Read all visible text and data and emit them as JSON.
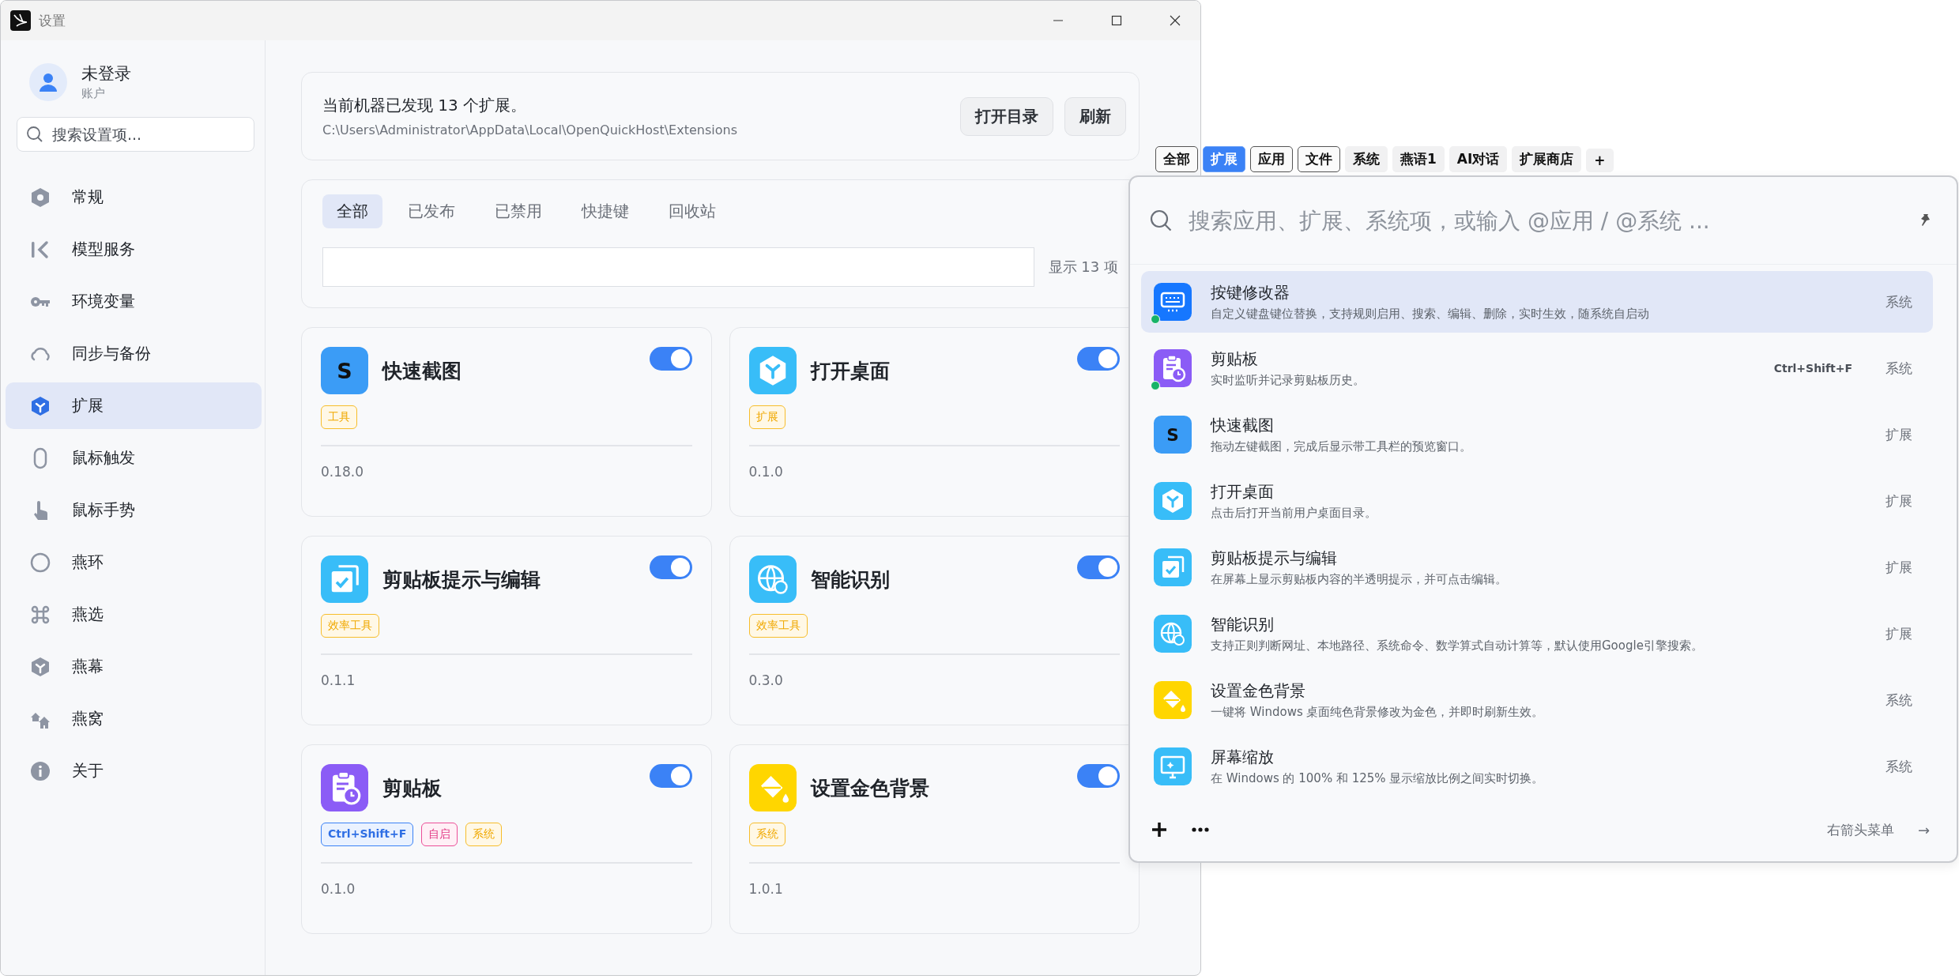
{
  "window": {
    "title": "设置"
  },
  "sidebar": {
    "user": {
      "name": "未登录",
      "subtitle": "账户"
    },
    "search": {
      "placeholder": "搜索设置项..."
    },
    "items": [
      {
        "label": "常规",
        "kind": "hexagon",
        "selected": false
      },
      {
        "label": "模型服务",
        "kind": "chevron-bar",
        "selected": false
      },
      {
        "label": "环境变量",
        "kind": "key",
        "selected": false
      },
      {
        "label": "同步与备份",
        "kind": "cloud",
        "selected": false
      },
      {
        "label": "扩展",
        "kind": "cube",
        "selected": true
      },
      {
        "label": "鼠标触发",
        "kind": "mouse",
        "selected": false
      },
      {
        "label": "鼠标手势",
        "kind": "hand",
        "selected": false
      },
      {
        "label": "燕环",
        "kind": "ring",
        "selected": false
      },
      {
        "label": "燕选",
        "kind": "command",
        "selected": false
      },
      {
        "label": "燕幕",
        "kind": "cube",
        "selected": false
      },
      {
        "label": "燕窝",
        "kind": "houses",
        "selected": false
      },
      {
        "label": "关于",
        "kind": "info",
        "selected": false
      }
    ]
  },
  "summary": {
    "text": "当前机器已发现 13 个扩展。",
    "path": "C:\\Users\\Administrator\\AppData\\Local\\OpenQuickHost\\Extensions",
    "buttons": [
      "打开目录",
      "刷新"
    ]
  },
  "filter": {
    "tabs": [
      {
        "label": "全部",
        "selected": true
      },
      {
        "label": "已发布",
        "selected": false
      },
      {
        "label": "已禁用",
        "selected": false
      },
      {
        "label": "快捷键",
        "selected": false
      },
      {
        "label": "回收站",
        "selected": false
      }
    ],
    "count": "显示 13 项"
  },
  "cards": [
    {
      "title": "快速截图",
      "kind": "letter",
      "icon_text": "S",
      "on": true,
      "tags": [
        {
          "text": "工具",
          "kind": "category"
        }
      ],
      "version": "0.18.0"
    },
    {
      "title": "打开桌面",
      "kind": "cube",
      "on": true,
      "tags": [
        {
          "text": "扩展",
          "kind": "category"
        }
      ],
      "version": "0.1.0"
    },
    {
      "title": "剪贴板提示与编辑",
      "kind": "copy-check",
      "on": true,
      "tags": [
        {
          "text": "效率工具",
          "kind": "category"
        }
      ],
      "version": "0.1.1"
    },
    {
      "title": "智能识别",
      "kind": "globe",
      "on": true,
      "tags": [
        {
          "text": "效率工具",
          "kind": "category"
        }
      ],
      "version": "0.3.0"
    },
    {
      "title": "剪贴板",
      "kind": "clipboard",
      "on": true,
      "tags": [
        {
          "text": "Ctrl+Shift+F",
          "kind": "shortcut"
        },
        {
          "text": "自启",
          "kind": "autostart"
        },
        {
          "text": "系统",
          "kind": "category"
        }
      ],
      "version": "0.1.0"
    },
    {
      "title": "设置金色背景",
      "kind": "bucket",
      "on": true,
      "tags": [
        {
          "text": "系统",
          "kind": "category"
        }
      ],
      "version": "1.0.1"
    }
  ],
  "launcher": {
    "tabs": [
      {
        "label": "全部",
        "kind": "outlined",
        "selected": false
      },
      {
        "label": "扩展",
        "kind": "outlined",
        "selected": true
      },
      {
        "label": "应用",
        "kind": "outlined",
        "selected": false
      },
      {
        "label": "文件",
        "kind": "outlined",
        "selected": false
      },
      {
        "label": "系统",
        "kind": "plain",
        "selected": false
      },
      {
        "label": "燕语1",
        "kind": "plain",
        "selected": false
      },
      {
        "label": "AI对话",
        "kind": "plain",
        "selected": false
      },
      {
        "label": "扩展商店",
        "kind": "plain",
        "selected": false
      },
      {
        "label": "+",
        "kind": "plain",
        "selected": false
      }
    ],
    "search": {
      "placeholder": "搜索应用、扩展、系统项，或输入 @应用 / @系统 ..."
    },
    "results": [
      {
        "title": "按键修改器",
        "description": "自定义键盘键位替换，支持规则启用、搜索、编辑、删除，实时生效，随系统自启动",
        "kind": "keyboard",
        "running": true,
        "category": "系统",
        "selected": true
      },
      {
        "title": "剪贴板",
        "description": "实时监听并记录剪贴板历史。",
        "kind": "clipboard",
        "running": true,
        "shortcut": "Ctrl+Shift+F",
        "category": "系统",
        "selected": false
      },
      {
        "title": "快速截图",
        "description": "拖动左键截图，完成后显示带工具栏的预览窗口。",
        "kind": "letter",
        "icon_text": "S",
        "running": false,
        "category": "扩展",
        "selected": false
      },
      {
        "title": "打开桌面",
        "description": "点击后打开当前用户桌面目录。",
        "kind": "cube",
        "running": false,
        "category": "扩展",
        "selected": false
      },
      {
        "title": "剪贴板提示与编辑",
        "description": "在屏幕上显示剪贴板内容的半透明提示，并可点击编辑。",
        "kind": "copy-check",
        "running": false,
        "category": "扩展",
        "selected": false
      },
      {
        "title": "智能识别",
        "description": "支持正则判断网址、本地路径、系统命令、数学算式自动计算等，默认使用Google引擎搜索。",
        "kind": "globe",
        "running": false,
        "category": "扩展",
        "selected": false
      },
      {
        "title": "设置金色背景",
        "description": "一键将 Windows 桌面纯色背景修改为金色，并即时刷新生效。",
        "kind": "bucket",
        "running": false,
        "category": "系统",
        "selected": false
      },
      {
        "title": "屏幕缩放",
        "description": "在 Windows 的 100% 和 125% 显示缩放比例之间实时切换。",
        "kind": "monitor",
        "running": false,
        "category": "系统",
        "selected": false
      }
    ],
    "footer": {
      "hint": "右箭头菜单",
      "arrow": "→"
    }
  }
}
